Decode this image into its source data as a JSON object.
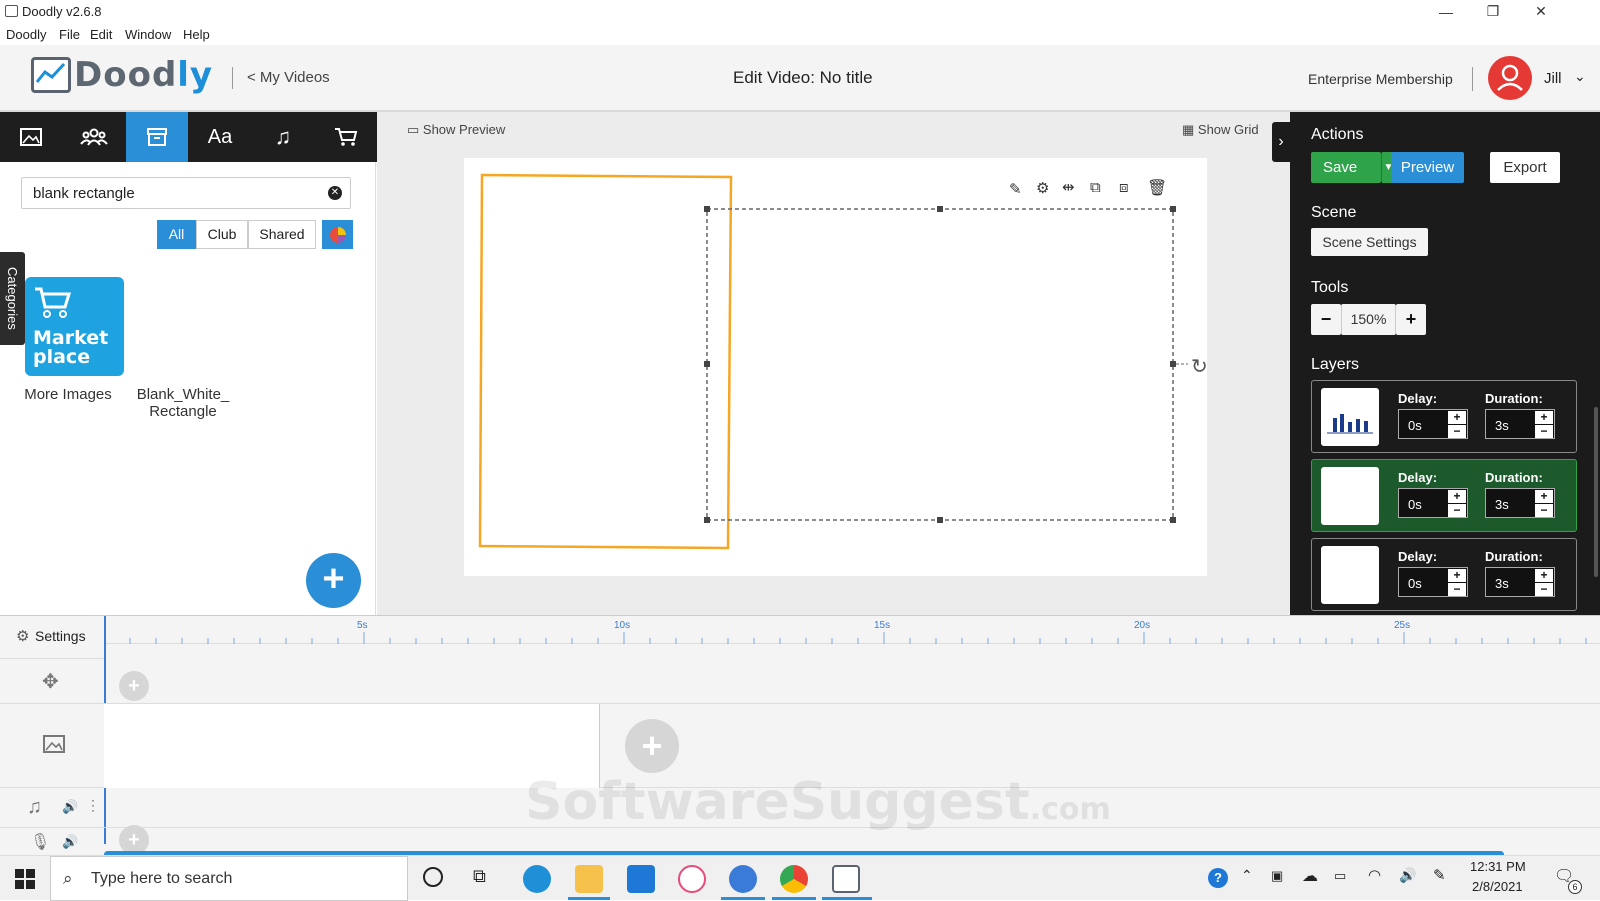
{
  "window": {
    "title": "Doodly v2.6.8",
    "minimize": "—",
    "restore": "❐",
    "close": "✕"
  },
  "menu": [
    "Doodly",
    "File",
    "Edit",
    "Window",
    "Help"
  ],
  "header": {
    "logo": "Doodly",
    "back_link": "< My Videos",
    "page_title": "Edit Video: No title",
    "membership": "Enterprise Membership",
    "user_name": "Jill"
  },
  "left_toolbar": {
    "icons": [
      "image-icon",
      "characters-icon",
      "props-icon",
      "text-icon",
      "music-icon",
      "cart-icon",
      "collapse-icon"
    ],
    "active": "props-icon"
  },
  "asset_panel": {
    "search_value": "blank rectangle",
    "filters": [
      "All",
      "Club",
      "Shared"
    ],
    "active_filter": "All",
    "categories_tab": "Categories",
    "marketplace_tile": "Market place",
    "items": [
      {
        "label": "More Images"
      },
      {
        "label": "Blank_White_ Rectangle"
      }
    ]
  },
  "canvas": {
    "show_preview": "Show Preview",
    "show_grid": "Show Grid"
  },
  "right_panel": {
    "actions_heading": "Actions",
    "save": "Save",
    "preview": "Preview",
    "export": "Export",
    "scene_heading": "Scene",
    "scene_settings": "Scene Settings",
    "tools_heading": "Tools",
    "zoom": "150%",
    "layers_heading": "Layers",
    "layers": [
      {
        "delay_label": "Delay:",
        "delay": "0s",
        "duration_label": "Duration:",
        "duration": "3s",
        "selected": false
      },
      {
        "delay_label": "Delay:",
        "delay": "0s",
        "duration_label": "Duration:",
        "duration": "3s",
        "selected": true
      },
      {
        "delay_label": "Delay:",
        "delay": "0s",
        "duration_label": "Duration:",
        "duration": "3s",
        "selected": false
      }
    ]
  },
  "timeline": {
    "settings": "Settings",
    "ticks": [
      "5s",
      "10s",
      "15s",
      "20s",
      "25s"
    ]
  },
  "watermark": {
    "main": "SoftwareSuggest",
    "suffix": ".com"
  },
  "taskbar": {
    "search_placeholder": "Type here to search",
    "time": "12:31 PM",
    "date": "2/8/2021",
    "notif_count": "6"
  },
  "colors": {
    "accent": "#2a8fd6",
    "save_green": "#2fa34a",
    "selection_orange": "#f5a623",
    "avatar_red": "#e53935"
  }
}
